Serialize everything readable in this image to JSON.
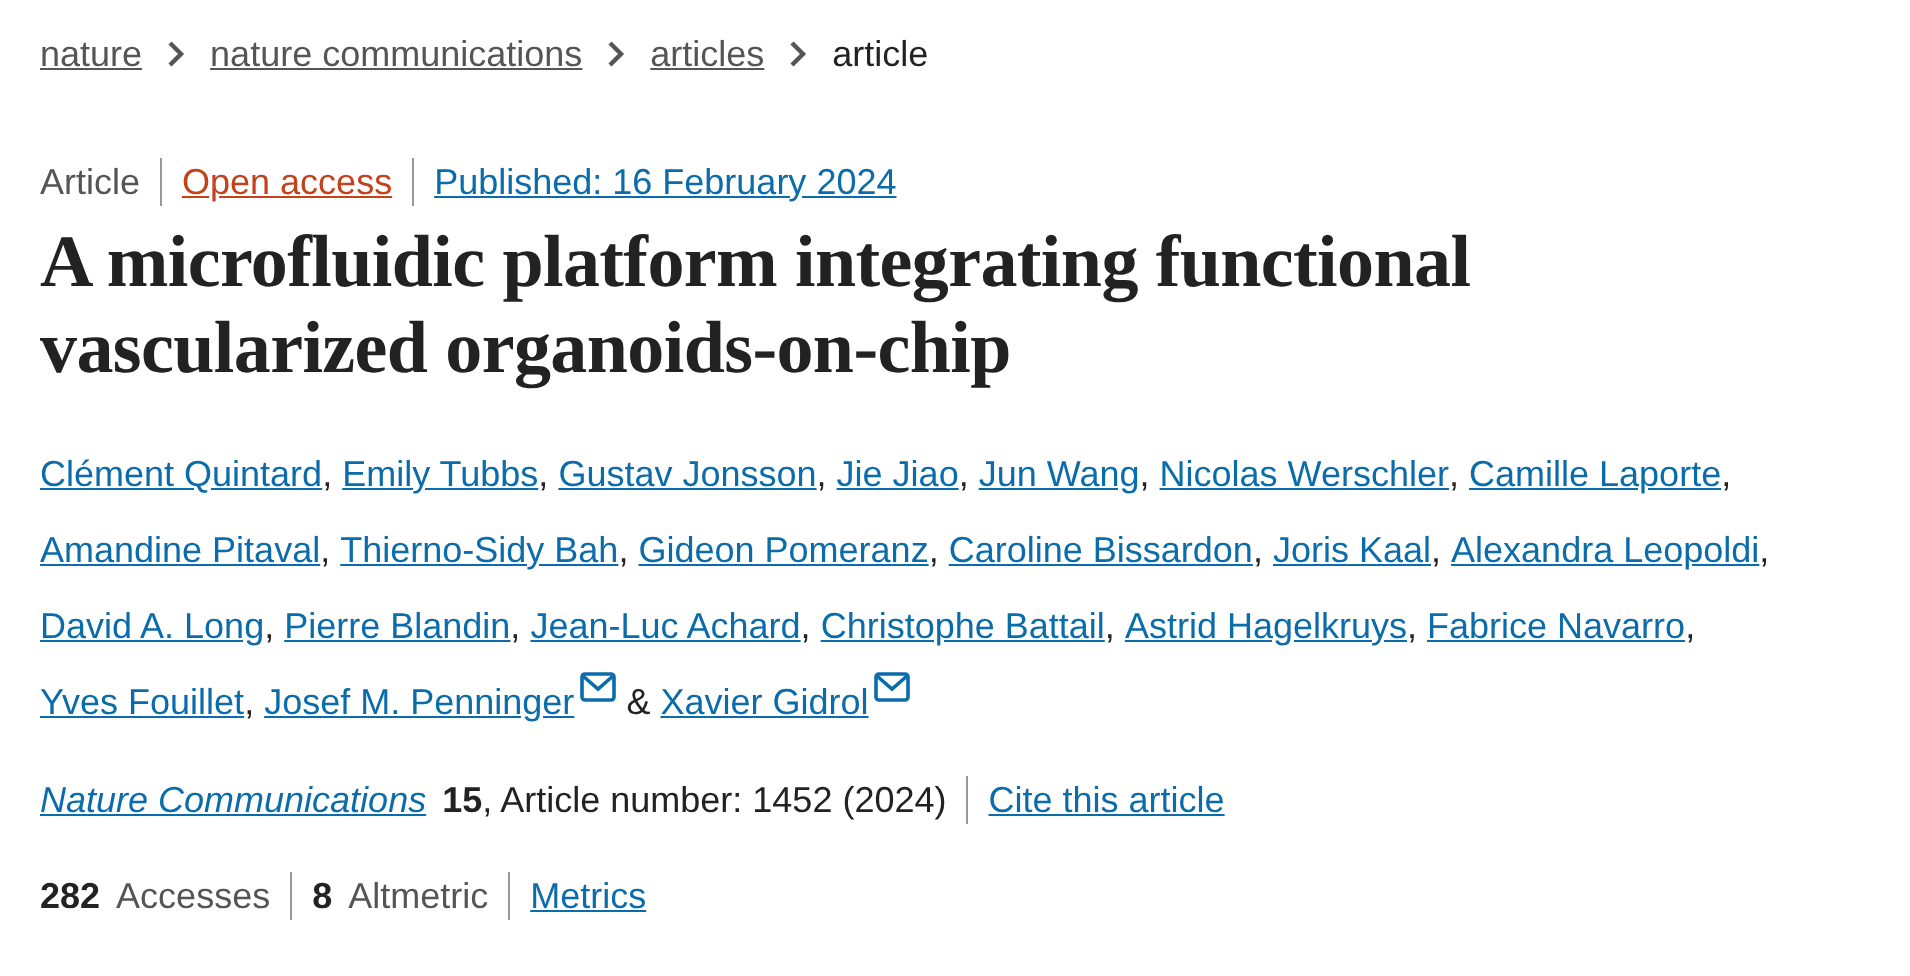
{
  "breadcrumbs": [
    {
      "label": "nature",
      "current": false
    },
    {
      "label": "nature communications",
      "current": false
    },
    {
      "label": "articles",
      "current": false
    },
    {
      "label": "article",
      "current": true
    }
  ],
  "article_meta": {
    "type": "Article",
    "access": "Open access",
    "published": "Published: 16 February 2024"
  },
  "title": "A microfluidic platform integrating functional vascularized organoids-on-chip",
  "authors": [
    {
      "name": "Clément Quintard",
      "email": false,
      "suffix": ","
    },
    {
      "name": "Emily Tubbs",
      "email": false,
      "suffix": ","
    },
    {
      "name": "Gustav Jonsson",
      "email": false,
      "suffix": ","
    },
    {
      "name": "Jie Jiao",
      "email": false,
      "suffix": ","
    },
    {
      "name": "Jun Wang",
      "email": false,
      "suffix": ","
    },
    {
      "name": "Nicolas Werschler",
      "email": false,
      "suffix": ","
    },
    {
      "name": "Camille Laporte",
      "email": false,
      "suffix": ","
    },
    {
      "name": "Amandine Pitaval",
      "email": false,
      "suffix": ","
    },
    {
      "name": "Thierno-Sidy Bah",
      "email": false,
      "suffix": ","
    },
    {
      "name": "Gideon Pomeranz",
      "email": false,
      "suffix": ","
    },
    {
      "name": "Caroline Bissardon",
      "email": false,
      "suffix": ","
    },
    {
      "name": "Joris Kaal",
      "email": false,
      "suffix": ","
    },
    {
      "name": "Alexandra Leopoldi",
      "email": false,
      "suffix": ","
    },
    {
      "name": "David A. Long",
      "email": false,
      "suffix": ","
    },
    {
      "name": "Pierre Blandin",
      "email": false,
      "suffix": ","
    },
    {
      "name": "Jean-Luc Achard",
      "email": false,
      "suffix": ","
    },
    {
      "name": "Christophe Battail",
      "email": false,
      "suffix": ","
    },
    {
      "name": "Astrid Hagelkruys",
      "email": false,
      "suffix": ","
    },
    {
      "name": "Fabrice Navarro",
      "email": false,
      "suffix": ","
    },
    {
      "name": "Yves Fouillet",
      "email": false,
      "suffix": ","
    },
    {
      "name": "Josef M. Penninger",
      "email": true,
      "suffix": "&"
    },
    {
      "name": "Xavier Gidrol",
      "email": true
    }
  ],
  "citation": {
    "journal": "Nature Communications",
    "details": "**15**, Article number: 1452 (2024)",
    "cite_link": "Cite this article"
  },
  "metrics": {
    "items": [
      {
        "count": "282",
        "label": "Accesses"
      },
      {
        "count": "8",
        "label": "Altmetric"
      }
    ],
    "link": "Metrics"
  }
}
